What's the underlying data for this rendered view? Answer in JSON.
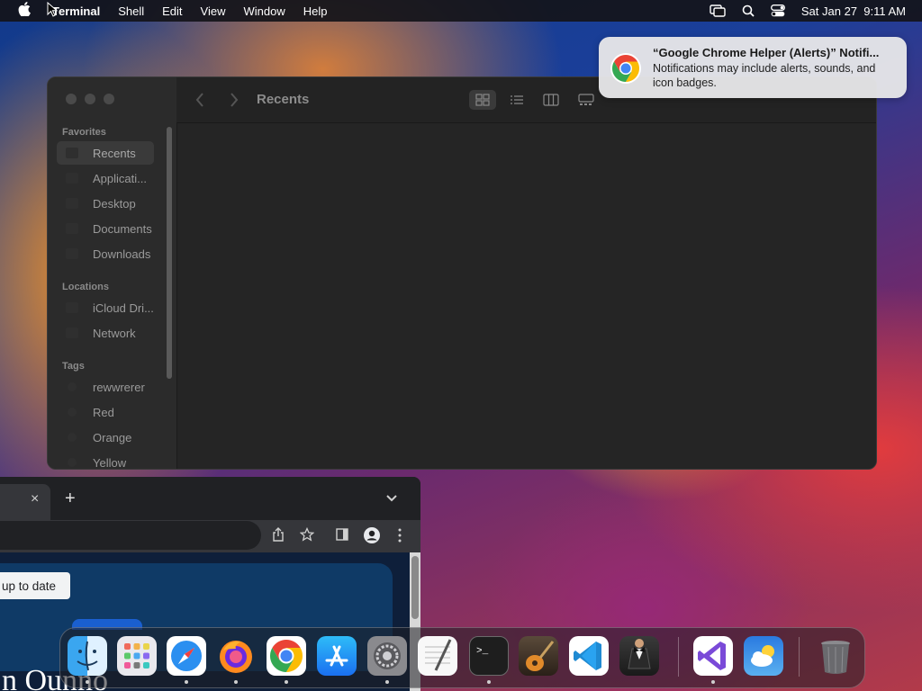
{
  "menubar": {
    "app_name": "Terminal",
    "menus": [
      "Shell",
      "Edit",
      "View",
      "Window",
      "Help"
    ],
    "datetime": "Sat Jan 27  9:11 AM"
  },
  "finder": {
    "title": "Recents",
    "sections": {
      "favorites": "Favorites",
      "locations": "Locations",
      "tags": "Tags"
    },
    "favorites": [
      "Recents",
      "Applicati...",
      "Desktop",
      "Documents",
      "Downloads"
    ],
    "locations": [
      "iCloud Dri...",
      "Network"
    ],
    "tags": [
      "rewwrerer",
      "Red",
      "Orange",
      "Yellow"
    ]
  },
  "notification": {
    "title": "“Google Chrome Helper (Alerts)” Notifi...",
    "body": "Notifications may include alerts, sounds, and icon badges."
  },
  "chrome": {
    "tab_close": "×",
    "new_tab": "+",
    "tooltip": "up to date",
    "big_text": "n Ounno"
  },
  "dock": {
    "apps": [
      "Finder",
      "Launchpad",
      "Safari",
      "Firefox",
      "Google Chrome",
      "App Store",
      "System Settings",
      "TextEdit",
      "Terminal",
      "GarageBand",
      "Visual Studio Code",
      "Bartender",
      "Visual Studio",
      "Weather",
      "Trash"
    ]
  },
  "colors": {
    "menubar_bg": "#141419",
    "finder_bg": "#262626",
    "notification_bg": "#e6e6e8",
    "chrome_bg": "#202124"
  }
}
